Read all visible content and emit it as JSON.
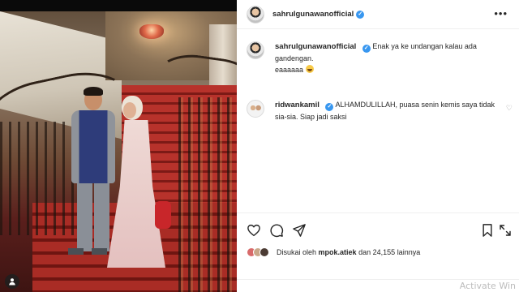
{
  "post": {
    "username": "sahrulgunawanofficial",
    "verified": true,
    "more_icon": "ellipsis-icon"
  },
  "caption": {
    "username": "sahrulgunawanofficial",
    "line1": "Enak ya ke undangan kalau ada gandengan.",
    "line2": "eaaaaaa",
    "emoji": "grinning-face-icon"
  },
  "comment": {
    "username": "ridwankamil",
    "verified": true,
    "text": "ALHAMDULILLAH, puasa senin kemis saya tidak sia-sia. Siap jadi saksi",
    "like_icon": "heart-outline-icon"
  },
  "actions": {
    "like": "heart-icon",
    "comment": "comment-icon",
    "share": "send-icon",
    "save": "bookmark-icon",
    "expand": "expand-icon"
  },
  "likes": {
    "prefix": "Disukai oleh",
    "user": "mpok.atiek",
    "middle": "dan",
    "count": "24,155",
    "suffix": "lainnya"
  },
  "photo": {
    "tag_icon": "user-tag-icon"
  },
  "watermark": "Activate Win"
}
